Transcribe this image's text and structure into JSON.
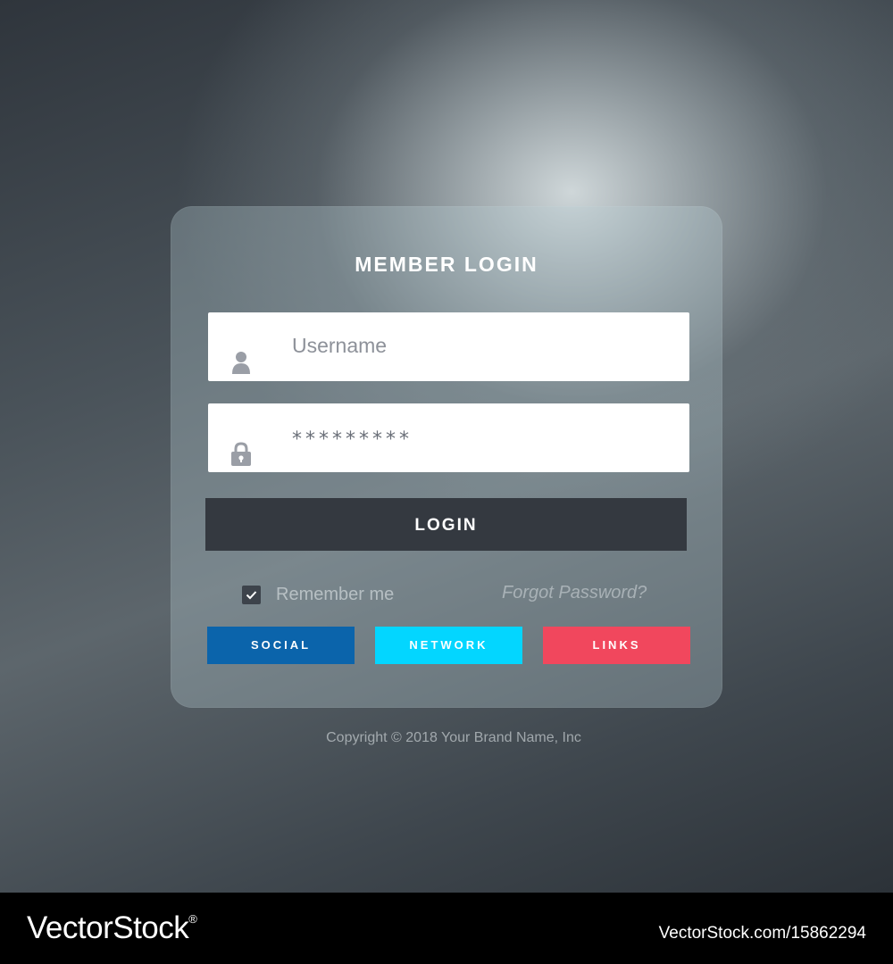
{
  "login_card": {
    "title": "MEMBER LOGIN",
    "username_placeholder": "Username",
    "password_value": "*********",
    "login_label": "LOGIN",
    "remember_me_label": "Remember me",
    "remember_me_checked": true,
    "forgot_password_label": "Forgot Password?",
    "user_icon": "user-icon",
    "lock_icon": "lock-icon",
    "check_icon": "check-icon"
  },
  "link_buttons": [
    {
      "label": "SOCIAL",
      "color": "#0b64ab"
    },
    {
      "label": "NETWORK",
      "color": "#03d6ff"
    },
    {
      "label": "LINKS",
      "color": "#f1475d"
    }
  ],
  "copyright": "Copyright © 2018 Your Brand Name, Inc",
  "watermark": {
    "brand": "VectorStock",
    "registered_mark": "®",
    "image_ref": "VectorStock.com/15862294"
  },
  "colors": {
    "login_button": "#343940",
    "card_text": "#ffffff",
    "footer_bg": "#000000"
  }
}
